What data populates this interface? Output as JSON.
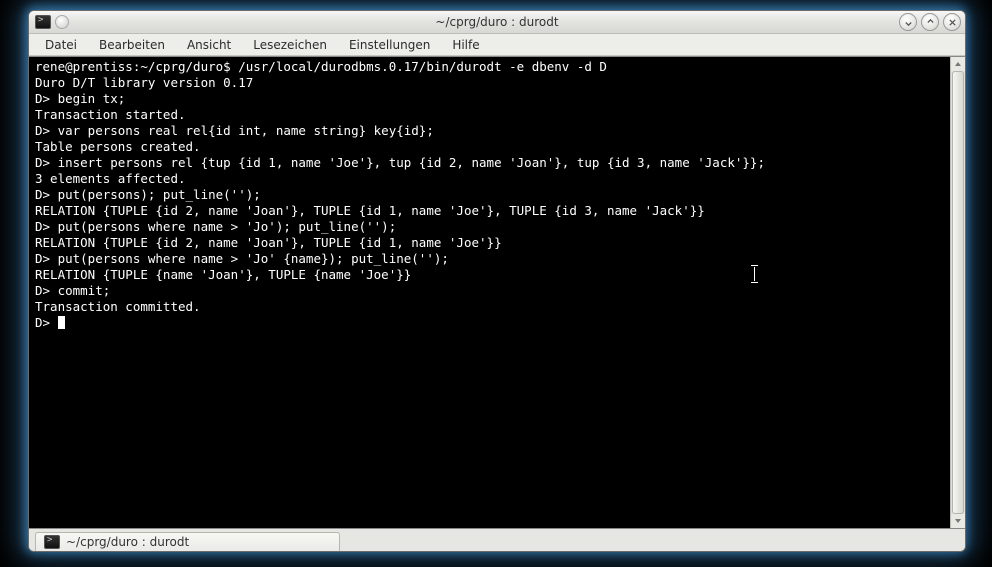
{
  "window": {
    "title": "~/cprg/duro : durodt"
  },
  "menubar": {
    "items": [
      "Datei",
      "Bearbeiten",
      "Ansicht",
      "Lesezeichen",
      "Einstellungen",
      "Hilfe"
    ]
  },
  "tab": {
    "label": "~/cprg/duro : durodt"
  },
  "terminal": {
    "lines": [
      "rene@prentiss:~/cprg/duro$ /usr/local/durodbms.0.17/bin/durodt -e dbenv -d D",
      "Duro D/T library version 0.17",
      "D> begin tx;",
      "Transaction started.",
      "D> var persons real rel{id int, name string} key{id};",
      "Table persons created.",
      "D> insert persons rel {tup {id 1, name 'Joe'}, tup {id 2, name 'Joan'}, tup {id 3, name 'Jack'}};",
      "3 elements affected.",
      "D> put(persons); put_line('');",
      "RELATION {TUPLE {id 2, name 'Joan'}, TUPLE {id 1, name 'Joe'}, TUPLE {id 3, name 'Jack'}}",
      "D> put(persons where name > 'Jo'); put_line('');",
      "RELATION {TUPLE {id 2, name 'Joan'}, TUPLE {id 1, name 'Joe'}}",
      "D> put(persons where name > 'Jo' {name}); put_line('');",
      "RELATION {TUPLE {name 'Joan'}, TUPLE {name 'Joe'}}",
      "D> commit;",
      "Transaction committed.",
      "D> "
    ]
  }
}
